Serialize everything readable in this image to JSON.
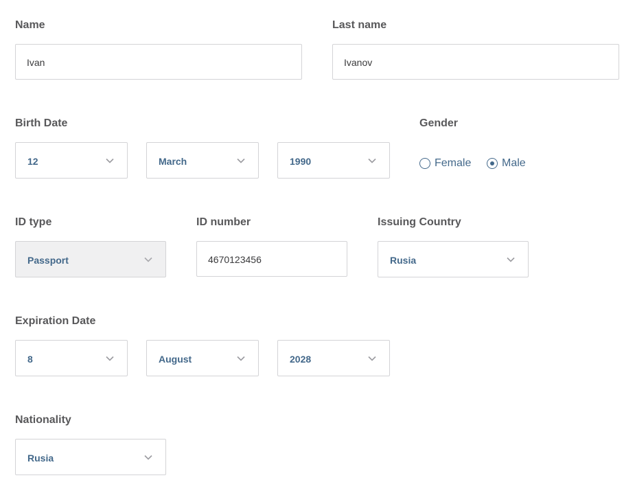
{
  "form": {
    "name": {
      "label": "Name",
      "value": "Ivan"
    },
    "last_name": {
      "label": "Last name",
      "value": "Ivanov"
    },
    "birth_date": {
      "label": "Birth Date",
      "day": "12",
      "month": "March",
      "year": "1990"
    },
    "gender": {
      "label": "Gender",
      "options": [
        "Female",
        "Male"
      ],
      "selected": "Male"
    },
    "id_type": {
      "label": "ID type",
      "value": "Passport",
      "disabled": true
    },
    "id_number": {
      "label": "ID number",
      "value": "4670123456"
    },
    "issuing_country": {
      "label": "Issuing Country",
      "value": "Rusia"
    },
    "expiration_date": {
      "label": "Expiration Date",
      "day": "8",
      "month": "August",
      "year": "2028"
    },
    "nationality": {
      "label": "Nationality",
      "value": "Rusia"
    }
  },
  "icons": {
    "select_arrow": "chevron-down-icon",
    "radio_selected": "radio-checked-icon",
    "radio_unselected": "radio-unchecked-icon"
  },
  "colors": {
    "label_text": "#58585a",
    "value_accent": "#43688a",
    "border": "#d3d3d6",
    "disabled_bg": "#f0f0f1"
  }
}
